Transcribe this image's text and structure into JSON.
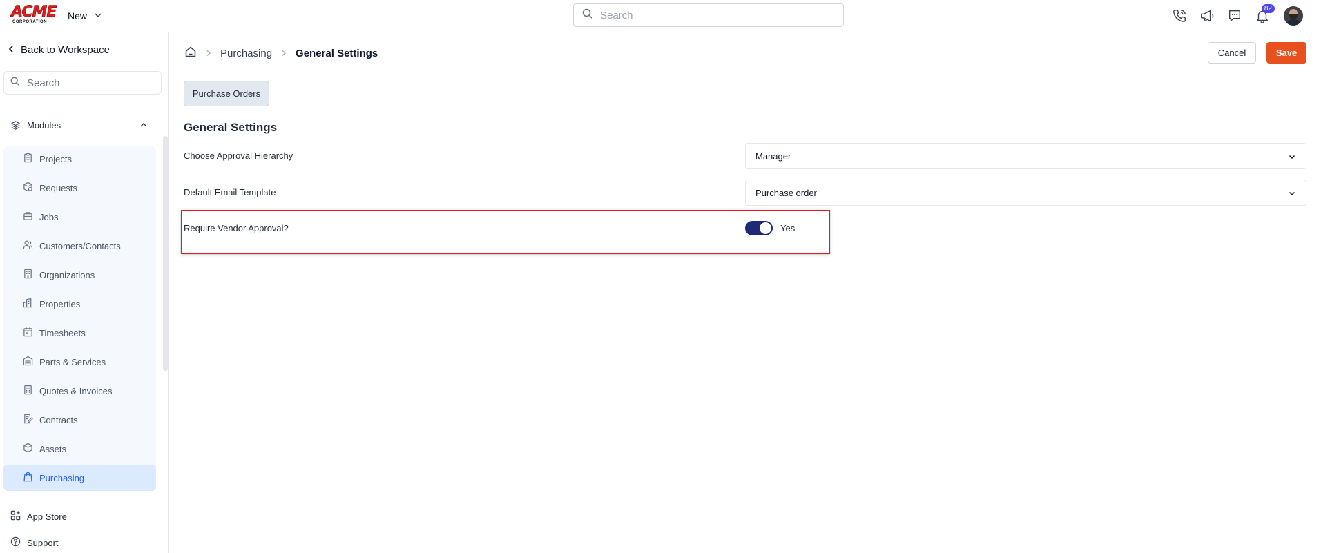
{
  "header": {
    "logo_text": "ACME",
    "logo_subtext": "CORPORATION",
    "new_label": "New",
    "search_placeholder": "Search",
    "notification_count": "82"
  },
  "sidebar": {
    "back_label": "Back to Workspace",
    "search_placeholder": "Search",
    "modules_label": "Modules",
    "items": [
      {
        "label": "Projects",
        "icon": "clipboard-icon"
      },
      {
        "label": "Requests",
        "icon": "request-box-icon"
      },
      {
        "label": "Jobs",
        "icon": "briefcase-icon"
      },
      {
        "label": "Customers/Contacts",
        "icon": "users-icon"
      },
      {
        "label": "Organizations",
        "icon": "building-icon"
      },
      {
        "label": "Properties",
        "icon": "property-icon"
      },
      {
        "label": "Timesheets",
        "icon": "calendar-icon"
      },
      {
        "label": "Parts & Services",
        "icon": "warehouse-icon"
      },
      {
        "label": "Quotes & Invoices",
        "icon": "calculator-icon"
      },
      {
        "label": "Contracts",
        "icon": "contract-icon"
      },
      {
        "label": "Assets",
        "icon": "cube-icon"
      },
      {
        "label": "Purchasing",
        "icon": "shopping-bag-icon",
        "active": true
      }
    ],
    "app_store_label": "App Store",
    "support_label": "Support"
  },
  "breadcrumb": {
    "parent": "Purchasing",
    "current": "General Settings"
  },
  "actions": {
    "cancel_label": "Cancel",
    "save_label": "Save"
  },
  "tabs": [
    {
      "label": "Purchase Orders",
      "active": true
    }
  ],
  "settings": {
    "title": "General Settings",
    "approval_hierarchy": {
      "label": "Choose Approval Hierarchy",
      "value": "Manager"
    },
    "email_template": {
      "label": "Default Email Template",
      "value": "Purchase order"
    },
    "vendor_approval": {
      "label": "Require Vendor Approval?",
      "value": "Yes",
      "enabled": true
    }
  },
  "colors": {
    "accent_save": "#e8501f",
    "toggle_on": "#1e2a78",
    "active_nav": "#2563eb",
    "highlight_border": "#e11d24"
  }
}
